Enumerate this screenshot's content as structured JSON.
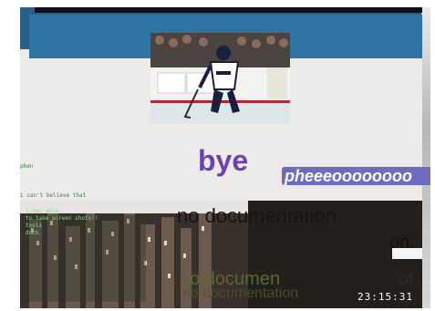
{
  "scene": {
    "bye_text": "bye",
    "phee_text": "pheeeoooooooo",
    "nodoc_top": "no documentation.",
    "nodoc_bottom": "no documen",
    "nodoc_ghost": "no documentation",
    "frag_on": "on.",
    "frag_of": "ot",
    "clock": "23:15:31"
  },
  "chat": {
    "top_line": "phen",
    "lines": [
      "i can't believe that",
      "i was able",
      "to take screen shots!!",
      "tools",
      "dock",
      "",
      "",
      ""
    ]
  },
  "colors": {
    "header_blue": "#2e74a3",
    "bye_purple": "#6e41b0",
    "phee_bg": "#6f6bbf",
    "chat_green": "#7ee37e"
  }
}
